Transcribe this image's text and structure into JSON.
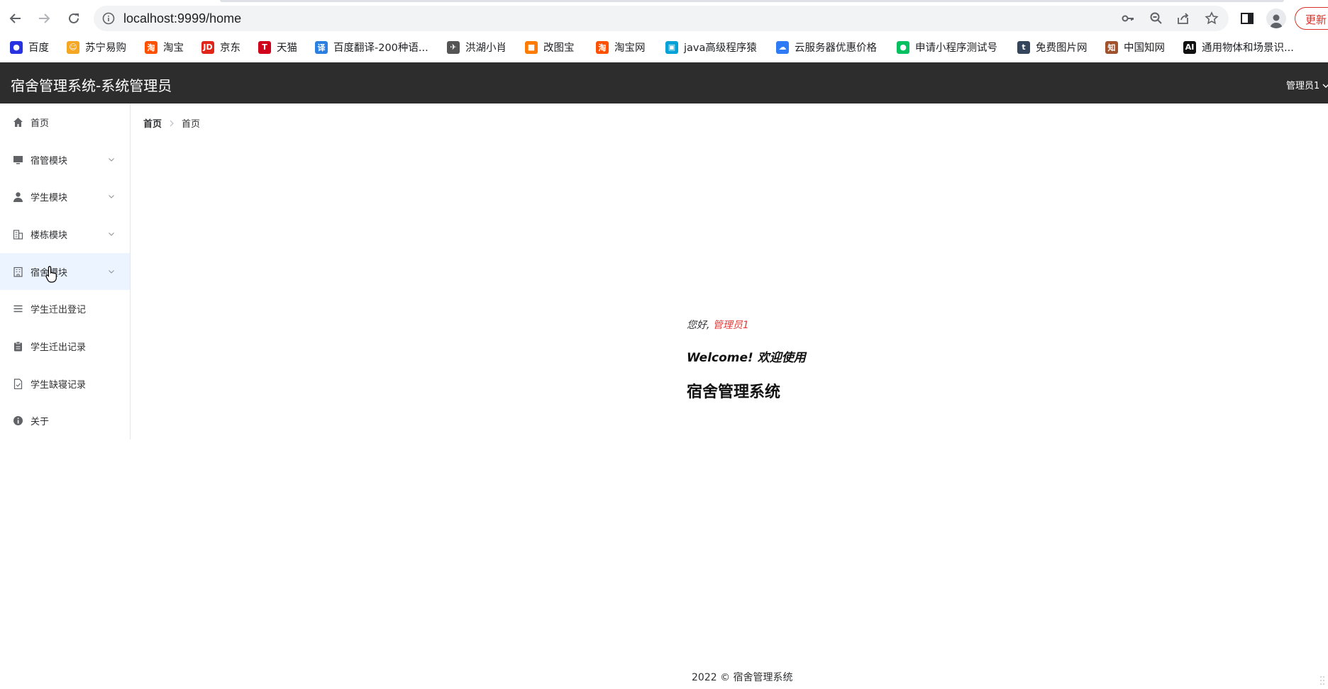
{
  "browser": {
    "url": "localhost:9999/home",
    "update_label": "更新",
    "bookmarks": [
      {
        "label": "百度",
        "icon": "baidu-paw-icon",
        "color": "#2932e1"
      },
      {
        "label": "苏宁易购",
        "icon": "suning-lion-icon",
        "color": "#f5a623"
      },
      {
        "label": "淘宝",
        "icon": "taobao-icon",
        "color": "#ff5000"
      },
      {
        "label": "京东",
        "icon": "jd-icon",
        "color": "#e1251b"
      },
      {
        "label": "天猫",
        "icon": "tmall-icon",
        "color": "#d0021b"
      },
      {
        "label": "百度翻译-200种语...",
        "icon": "baidu-translate-icon",
        "color": "#2b7fe0"
      },
      {
        "label": "洪湖小肖",
        "icon": "bird-icon",
        "color": "#555555"
      },
      {
        "label": "改图宝",
        "icon": "gaitubao-icon",
        "color": "#ff7a00"
      },
      {
        "label": "淘宝网",
        "icon": "taobao-web-icon",
        "color": "#ff5000"
      },
      {
        "label": "java高级程序猿",
        "icon": "bilibili-tv-icon",
        "color": "#00a1d6"
      },
      {
        "label": "云服务器优惠价格",
        "icon": "cloud-icon",
        "color": "#2f7bf5"
      },
      {
        "label": "申请小程序测试号",
        "icon": "wechat-icon",
        "color": "#07c160"
      },
      {
        "label": "免费图片网",
        "icon": "tumblr-icon",
        "color": "#35465c"
      },
      {
        "label": "中国知网",
        "icon": "cnki-icon",
        "color": "#a0522d"
      },
      {
        "label": "通用物体和场景识...",
        "icon": "ai-icon",
        "color": "#111111"
      }
    ]
  },
  "header": {
    "title": "宿舍管理系统-系统管理员",
    "user": "管理员1"
  },
  "sidebar": {
    "items": [
      {
        "label": "首页",
        "icon": "home-icon",
        "submenu": false
      },
      {
        "label": "宿管模块",
        "icon": "monitor-icon",
        "submenu": true
      },
      {
        "label": "学生模块",
        "icon": "user-icon",
        "submenu": true
      },
      {
        "label": "楼栋模块",
        "icon": "building-icon",
        "submenu": true
      },
      {
        "label": "宿舍模块",
        "icon": "office-icon",
        "submenu": true
      },
      {
        "label": "学生迁出登记",
        "icon": "list-icon",
        "submenu": false
      },
      {
        "label": "学生迁出记录",
        "icon": "clipboard-icon",
        "submenu": false
      },
      {
        "label": "学生缺寝记录",
        "icon": "document-icon",
        "submenu": false
      },
      {
        "label": "关于",
        "icon": "info-icon",
        "submenu": false
      }
    ]
  },
  "breadcrumb": {
    "first": "首页",
    "last": "首页"
  },
  "welcome": {
    "greeting_prefix": "您好,",
    "user_name": "管理员1",
    "line": "Welcome! 欢迎使用",
    "system_name": "宿舍管理系统"
  },
  "footer": {
    "text": "2022 © 宿舍管理系统"
  },
  "colors": {
    "header_bg": "#2d2d2d",
    "accent_red": "#e03c3c",
    "hover_bg": "#ecf5ff"
  }
}
